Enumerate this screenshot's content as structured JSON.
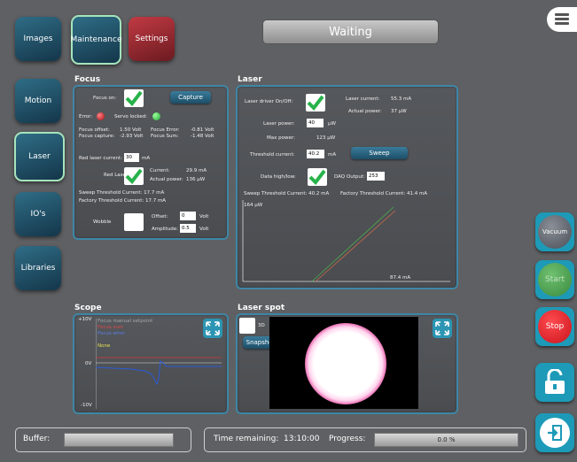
{
  "nav_top": {
    "images": "Images",
    "maintenance": "Maintenance",
    "settings": "Settings"
  },
  "nav_side": {
    "motion": "Motion",
    "laser": "Laser",
    "ios": "IO's",
    "libraries": "Libraries"
  },
  "status": "Waiting",
  "focus": {
    "title": "Focus",
    "focus_on_label": "Focus on:",
    "capture_label": "Capture",
    "error_label": "Error:",
    "servo_label": "Servo locked:",
    "focus_offset_label": "Focus offset:",
    "focus_offset_value": "1.50 Volt",
    "focus_capture_label": "Focus capture:",
    "focus_capture_value": "-2.93 Volt",
    "focus_error_label": "Focus Error:",
    "focus_error_value": "-0.81 Volt",
    "focus_sum_label": "Focus Sum:",
    "focus_sum_value": "-1.48 Volt",
    "red_laser_current_label": "Red laser current:",
    "red_laser_current_value": "30",
    "red_laser_current_unit": "mA",
    "red_laser_label": "Red Laser",
    "current_label": "Current:",
    "current_value": "29.9 mA",
    "actual_power_label": "Actual power:",
    "actual_power_value": "136 µW",
    "sweep_threshold": "Sweep Threshold Current: 17.7 mA",
    "factory_threshold": "Factory Threshold Current: 17.7 mA",
    "wobble_label": "Wobble",
    "offset_label": "Offset:",
    "offset_value": "0",
    "offset_unit": "Volt",
    "amplitude_label": "Amplitude:",
    "amplitude_value": "0.5",
    "amplitude_unit": "Volt"
  },
  "laser": {
    "title": "Laser",
    "driver_label": "Laser driver On/Off:",
    "laser_current_label": "Laser current:",
    "laser_current_value": "55.3 mA",
    "actual_power_label": "Actual power:",
    "actual_power_value": "37 µW",
    "laser_power_label": "Laser power:",
    "laser_power_value": "40",
    "laser_power_unit": "µW",
    "max_power_label": "Max power:",
    "max_power_value": "123 µW",
    "threshold_label": "Threshold current:",
    "threshold_value": "40.2",
    "threshold_unit": "mA",
    "sweep_label": "Sweep",
    "data_label": "Data high/low:",
    "daq_label": "DAQ Output:",
    "daq_value": "253",
    "sweep_threshold": "Sweep Threshold Current: 40.2 mA",
    "factory_threshold": "Factory Threshold Current: 41.4 mA",
    "chart_y_label": "164 µW",
    "chart_x_label": "87.4 mA"
  },
  "scope": {
    "title": "Scope",
    "y_top": "+10V",
    "y_mid": "0V",
    "y_bot": "-10V",
    "legend": [
      "Focus manual setpoint",
      "Focus sum",
      "Focus error",
      "None"
    ]
  },
  "laser_spot": {
    "title": "Laser spot",
    "threed_label": "3D",
    "snapshot_label": "Snapshot"
  },
  "right_buttons": {
    "vacuum": "Vacuum",
    "start": "Start",
    "stop": "Stop"
  },
  "bottom": {
    "buffer_label": "Buffer:",
    "time_label": "Time remaining:",
    "time_value": "13:10:00",
    "progress_label": "Progress:",
    "progress_value": "0.0 %"
  },
  "colors": {
    "accent": "#3e86a6",
    "check": "#27b24a",
    "stop": "#e01f26",
    "start": "#3fa14c"
  }
}
